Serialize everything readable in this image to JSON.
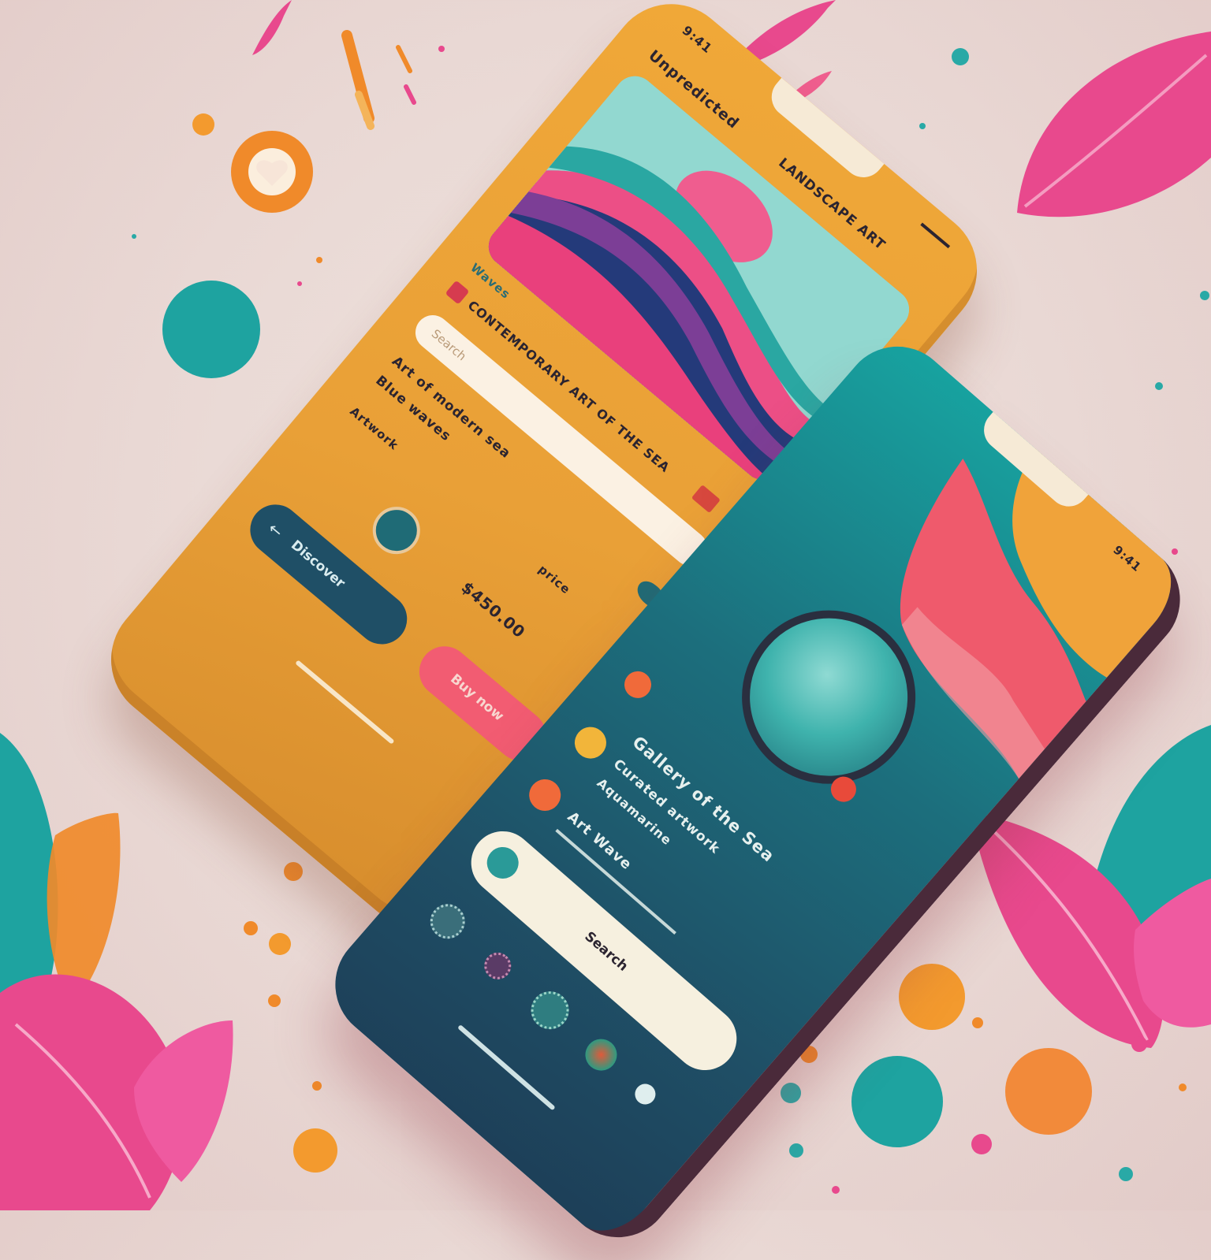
{
  "colors": {
    "background": "#ebdcd7",
    "yellow_phone": "#eba237",
    "teal_phone": "#1a7a84",
    "navy": "#1f4f66",
    "pink": "#ef3f8a",
    "coral": "#f25c72",
    "orange": "#f08a2a",
    "teal": "#1ea7a0",
    "cream": "#f6ead6"
  },
  "yellow_phone": {
    "status_time": "9:41",
    "header_left": "Unpredicted",
    "header_right": "LANDSCAPE ART",
    "image_tags": "Waves",
    "row_text": "CONTEMPORARY ART OF THE SEA",
    "input_label": "Search",
    "desc_line_1": "Art of modern sea",
    "desc_line_2": "Blue waves",
    "meta_left": "Artwork",
    "meta_right": "price",
    "price_text": "$450.00",
    "primary_button": "Discover",
    "secondary_button": "Buy now"
  },
  "teal_phone": {
    "status_time": "9:41",
    "title": "Gallery of the Sea",
    "subtitle_1": "Curated artwork",
    "subtitle_2": "Aquamarine",
    "item_title": "Art Wave",
    "search_label": "Search"
  }
}
